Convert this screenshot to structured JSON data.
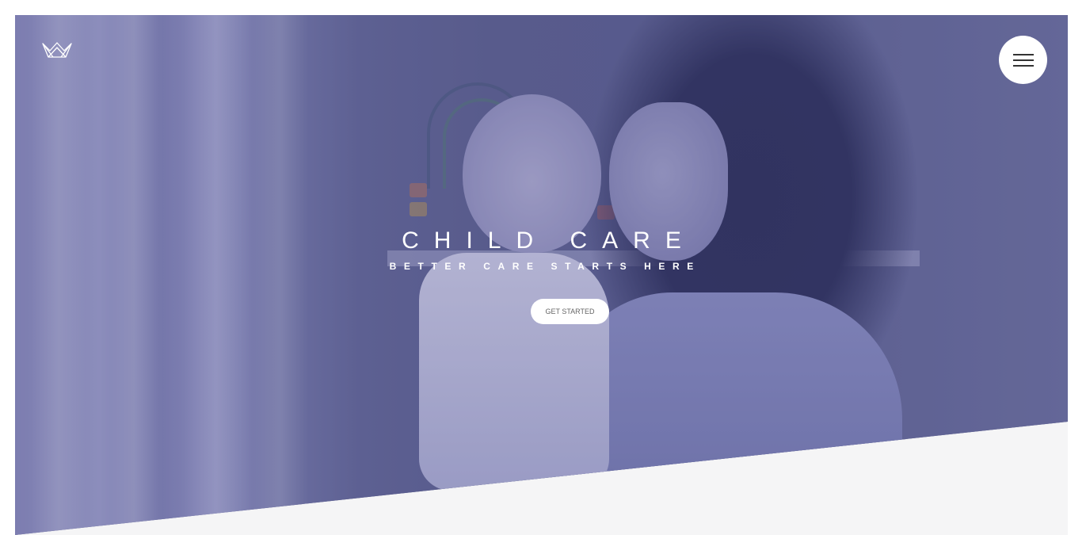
{
  "header": {
    "logo_icon": "crown-outline-icon",
    "menu_icon": "hamburger-menu-icon"
  },
  "hero": {
    "title": "CHILD CARE",
    "subtitle": "BETTER CARE STARTS HERE",
    "cta_label": "GET STARTED"
  },
  "colors": {
    "overlay_tint": "#5b5e86",
    "section_below": "#f5f5f6",
    "button_bg": "#ffffff"
  }
}
